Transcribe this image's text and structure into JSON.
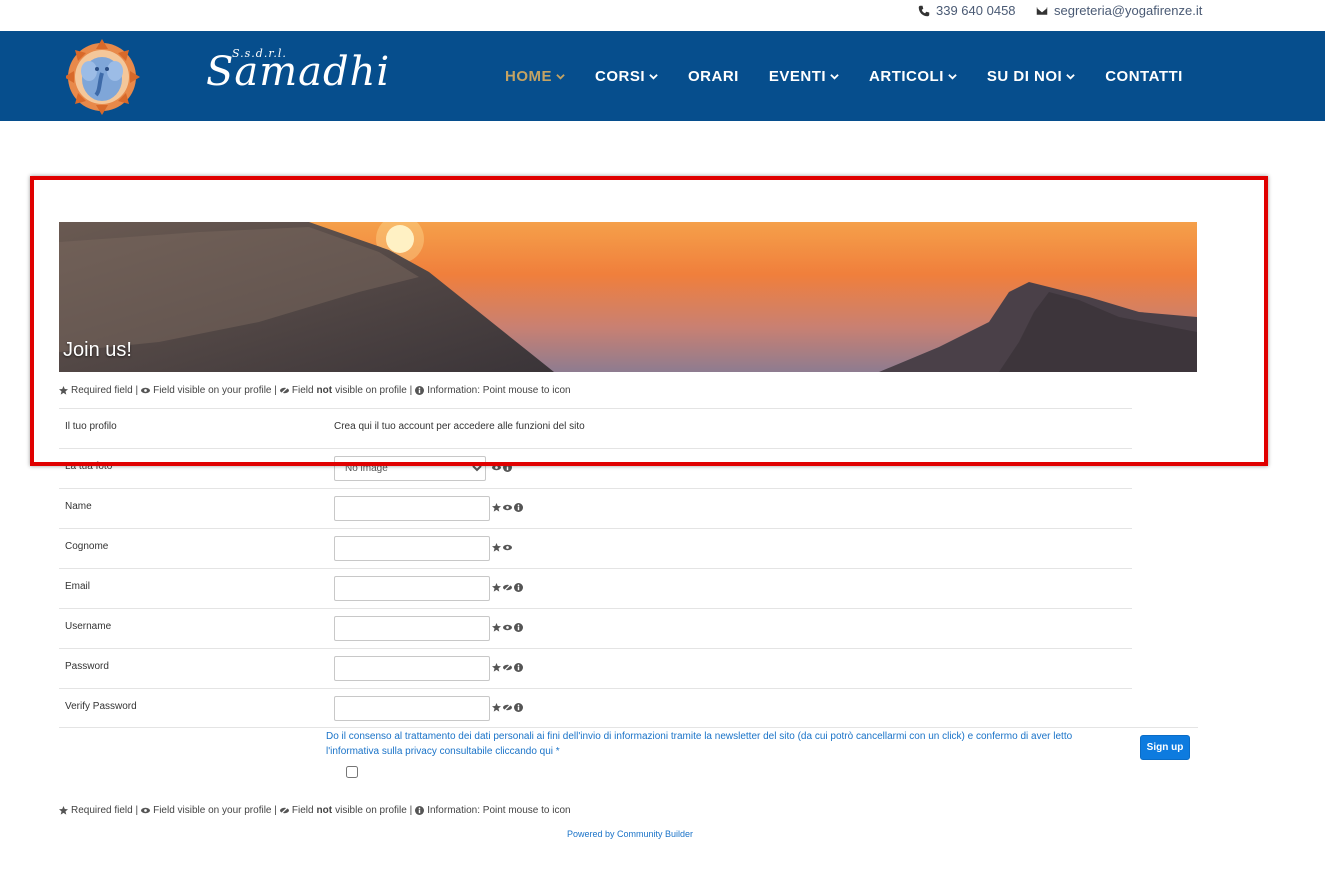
{
  "contact": {
    "phone": "339 640 0458",
    "email": "segreteria@yogafirenze.it"
  },
  "logo": {
    "name": "Samadhi",
    "sub": "S.s.d.r.l."
  },
  "nav": {
    "items": [
      {
        "label": "HOME",
        "has_dropdown": true,
        "active": true
      },
      {
        "label": "CORSI",
        "has_dropdown": true
      },
      {
        "label": "ORARI",
        "has_dropdown": false
      },
      {
        "label": "EVENTI",
        "has_dropdown": true
      },
      {
        "label": "ARTICOLI",
        "has_dropdown": true
      },
      {
        "label": "SU DI NOI",
        "has_dropdown": true
      },
      {
        "label": "CONTATTI",
        "has_dropdown": false
      }
    ]
  },
  "banner": {
    "title": "Join us!"
  },
  "legend": {
    "required": "Required field |",
    "visible": "Field visible on your profile |",
    "not_visible_pre": "Field",
    "not_visible_bold": "not",
    "not_visible_post": "visible on profile |",
    "info": "Information: Point mouse to icon"
  },
  "form": {
    "profile_label": "Il tuo profilo",
    "profile_value": "Crea qui il tuo account per accedere alle funzioni del sito",
    "photo_label": "La tua foto",
    "photo_select_value": "No image",
    "fields": [
      {
        "label": "Name"
      },
      {
        "label": "Cognome"
      },
      {
        "label": "Email"
      },
      {
        "label": "Username"
      },
      {
        "label": "Password"
      },
      {
        "label": "Verify Password"
      }
    ]
  },
  "consent": {
    "text": "Do il consenso al trattamento dei dati personali ai fini dell'invio di informazioni tramite la newsletter del sito (da cui potrò cancellarmi con un click) e confermo di aver letto l'informativa sulla privacy consultabile cliccando qui *"
  },
  "signup": {
    "label": "Sign up"
  },
  "footer": {
    "powered": "Powered by Community Builder"
  },
  "colors": {
    "navbar": "#064e8d",
    "nav_active": "#c4a363",
    "link": "#1a73c8",
    "button": "#0d7bdf",
    "highlight": "#e00000"
  }
}
